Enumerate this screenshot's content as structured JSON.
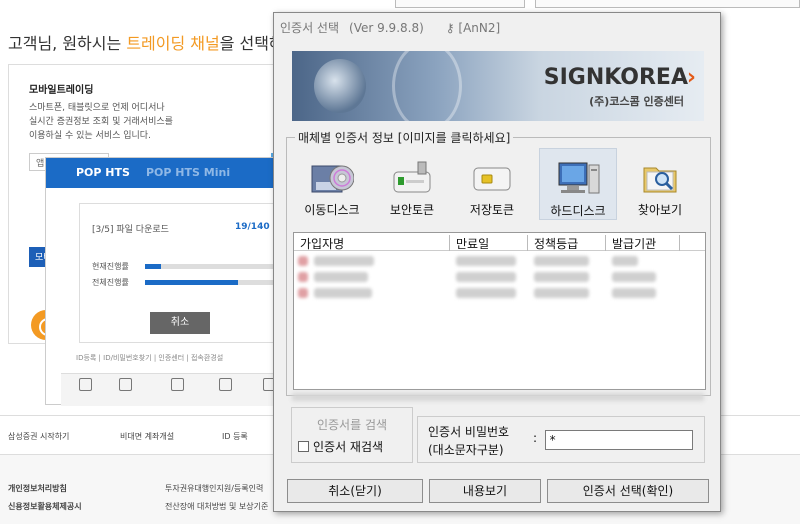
{
  "background": {
    "greeting_prefix": "고객님, 원하시는 ",
    "greeting_highlight": "트레이딩 채널",
    "greeting_suffix": "을 선택해",
    "card_title": "모바일트레이딩",
    "card_desc": "스마트폰, 태블릿으로 언제 어디서나\n실시간 증권정보 조회 및 거래서비스를\n이용하실 수 있는 서비스 입니다.",
    "select_value": "앱다",
    "blue_button": "모바",
    "hts_title": "POP HTS",
    "hts_title_mini": "POP HTS Mini",
    "hts_file": "[3/5] 파일 다운로드",
    "hts_count": "19/140",
    "hts_current": "현재진행률",
    "hts_total": "전체진행률",
    "hts_current_progress": 0.12,
    "hts_total_progress": 0.7,
    "hts_cancel": "취소",
    "hts_links": "ID등록 | ID/비밀번호찾기 | 인증센터 | 접속환경설",
    "footer_links": [
      "삼성증권 시작하기",
      "비대면 계좌개설",
      "ID 등록"
    ],
    "footer2": [
      "개인정보처리방침",
      "신용정보활용체제공시",
      "투자권유대행인지원/등록인력",
      "전산장애 대처방법 및 보상기준"
    ]
  },
  "dialog": {
    "title": "인증서 선택",
    "version": "(Ver 9.9.8.8)",
    "key_label": "[AnN2]",
    "logo": "SIGNKOREA",
    "logo_sub": "(주)코스콤 인증센터",
    "group_title": "매체별 인증서 정보 [이미지를 클릭하세요]",
    "media": [
      {
        "label": "이동디스크",
        "icon": "removable-disk-icon"
      },
      {
        "label": "보안토큰",
        "icon": "security-token-icon"
      },
      {
        "label": "저장토큰",
        "icon": "storage-token-icon"
      },
      {
        "label": "하드디스크",
        "icon": "hard-disk-icon",
        "selected": true
      },
      {
        "label": "찾아보기",
        "icon": "browse-icon"
      }
    ],
    "columns": [
      "가입자명",
      "만료일",
      "정책등급",
      "발급기관"
    ],
    "search_button": "인증서를 검색",
    "recheck_label": "인증서 재검색",
    "pw_label1": "인증서 비밀번호",
    "pw_label2": "(대소문자구분)",
    "pw_colon": ":",
    "pw_value": "*",
    "cancel_button": "취소(닫기)",
    "view_button": "내용보기",
    "confirm_button": "인증서 선택(확인)",
    "accent_color": "#e35a18"
  }
}
